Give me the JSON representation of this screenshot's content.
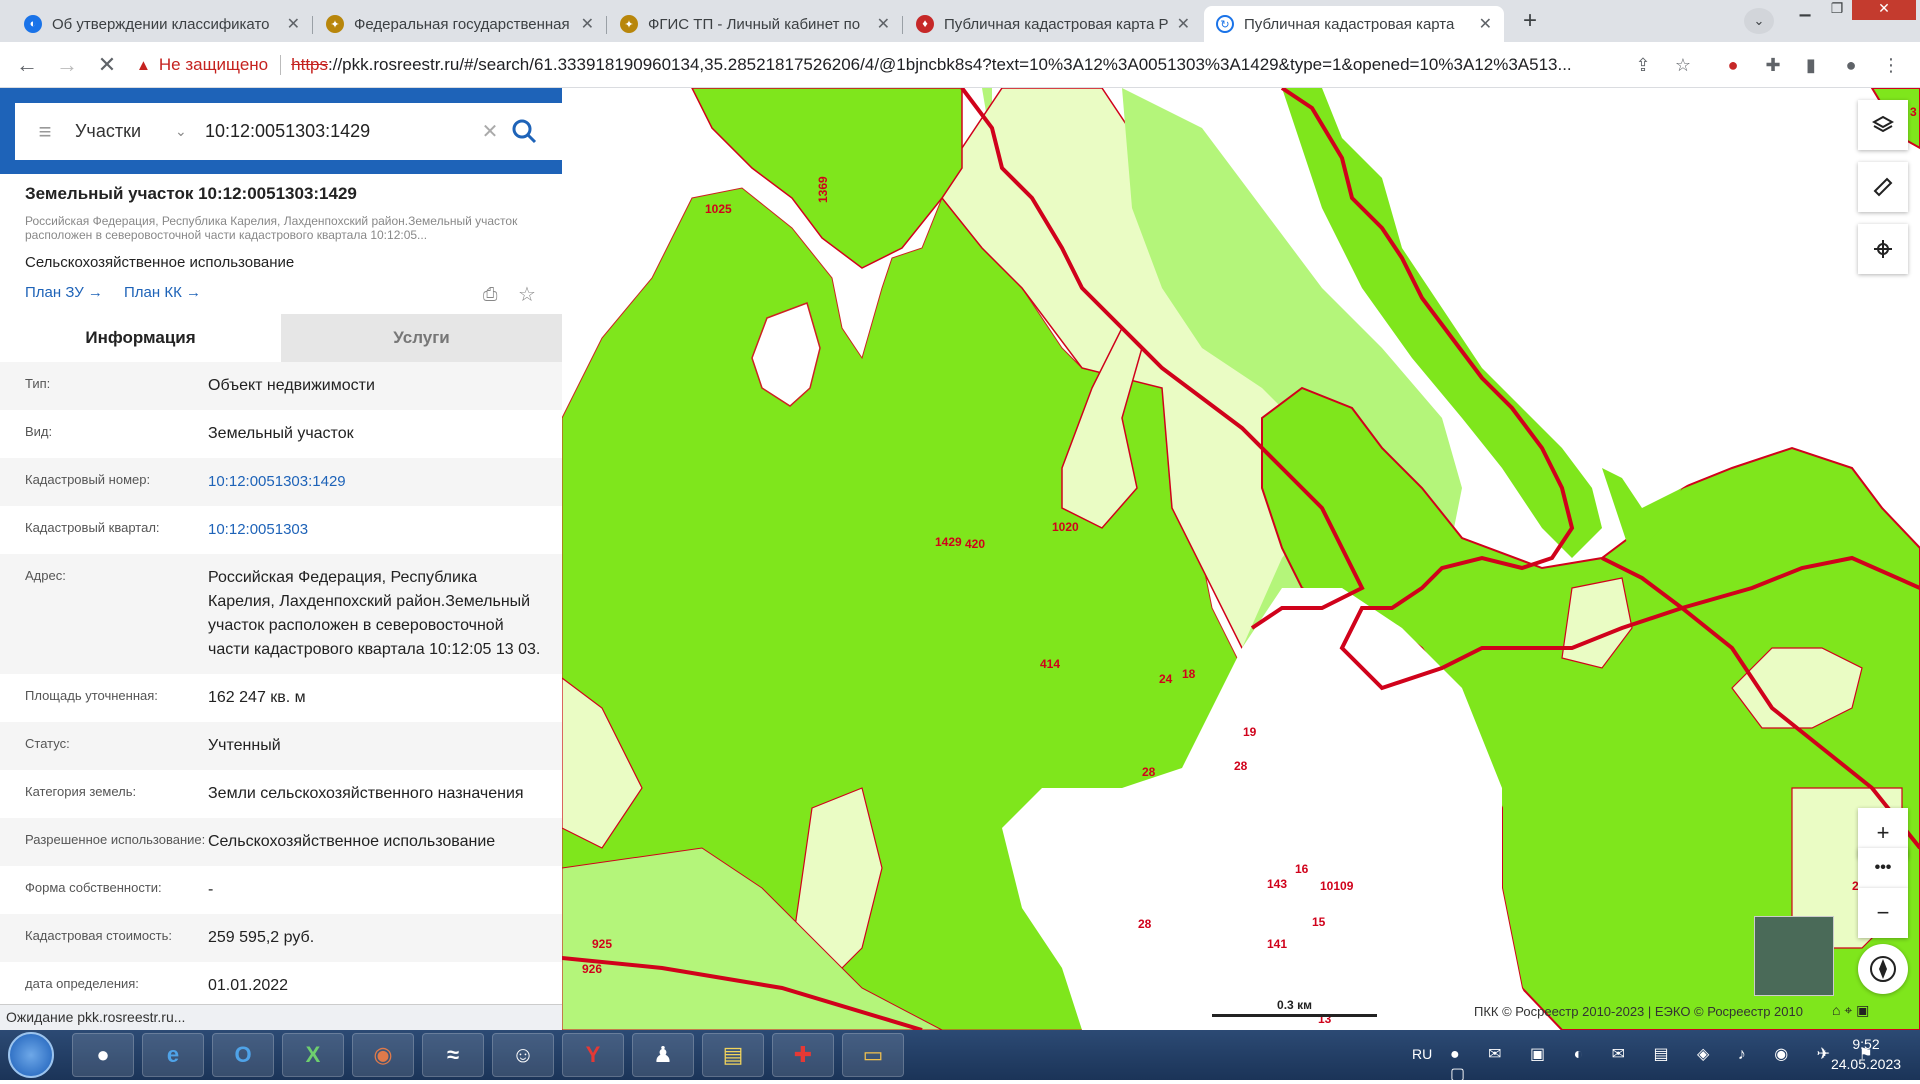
{
  "browser": {
    "tabs": [
      {
        "title": "Об утверждении классификато",
        "favicon_color": "#1a73e8",
        "active": false
      },
      {
        "title": "Федеральная государственная и",
        "favicon_color": "#b8860b",
        "active": false
      },
      {
        "title": "ФГИС ТП - Личный кабинет по",
        "favicon_color": "#b8860b",
        "active": false
      },
      {
        "title": "Публичная кадастровая карта Р",
        "favicon_color": "#c62828",
        "active": false
      },
      {
        "title": "Публичная кадастровая карта",
        "favicon_color": "#1a73e8",
        "active": true
      }
    ],
    "address": {
      "not_secure": "Не защищено",
      "scheme": "https",
      "rest": "://pkk.rosreestr.ru/#/search/61.333918190960134,35.28521817526206/4/@1bjncbk8s4?text=10%3A12%3A0051303%3A1429&type=1&opened=10%3A12%3A513..."
    },
    "status": "Ожидание pkk.rosreestr.ru..."
  },
  "search": {
    "type": "Участки",
    "value": "10:12:0051303:1429"
  },
  "object": {
    "title": "Земельный участок 10:12:0051303:1429",
    "address_short": "Российская Федерация, Республика Карелия, Лахденпохский район.Земельный участок расположен в северовосточной части кадастрового квартала 10:12:05...",
    "usage": "Сельскохозяйственное использование",
    "links": [
      "План ЗУ →",
      "План КК →"
    ],
    "tabs": [
      "Информация",
      "Услуги"
    ],
    "rows": [
      {
        "label": "Тип:",
        "value": "Объект недвижимости"
      },
      {
        "label": "Вид:",
        "value": "Земельный участок"
      },
      {
        "label": "Кадастровый номер:",
        "value": "10:12:0051303:1429",
        "link": true
      },
      {
        "label": "Кадастровый квартал:",
        "value": "10:12:0051303",
        "link": true
      },
      {
        "label": "Адрес:",
        "value": "Российская Федерация, Республика Карелия, Лахденпохский район.Земельный участок расположен в северовосточной части кадастрового квартала 10:12:05 13 03."
      },
      {
        "label": "Площадь уточненная:",
        "value": "162 247 кв. м"
      },
      {
        "label": "Статус:",
        "value": "Учтенный"
      },
      {
        "label": "Категория земель:",
        "value": "Земли сельскохозяйственного назначения"
      },
      {
        "label": "Разрешенное использование:",
        "value": "Сельскохозяйственное использование"
      },
      {
        "label": "Форма собственности:",
        "value": "-"
      },
      {
        "label": "Кадастровая стоимость:",
        "value": "259 595,2 руб."
      },
      {
        "label": "дата определения:",
        "value": "01.01.2022"
      }
    ]
  },
  "map": {
    "parcel_labels": [
      "1025",
      "1369",
      "1429",
      "420",
      "1020",
      "414",
      "24",
      "18",
      "19",
      "28",
      "28",
      "28",
      "16",
      "10109",
      "143",
      "141",
      "15",
      "28",
      "13",
      "925",
      "926",
      "3"
    ],
    "scale": "0.3 км",
    "attribution": "ПКК © Росреестр 2010-2023 | ЕЭКО © Росреестр 2010",
    "colors": {
      "green": "#7fe61c",
      "light": "#eafcc4",
      "mid": "#b4f57a",
      "border": "#d0021b"
    }
  },
  "taskbar": {
    "lang": "RU",
    "time": "9:52",
    "date": "24.05.2023"
  }
}
